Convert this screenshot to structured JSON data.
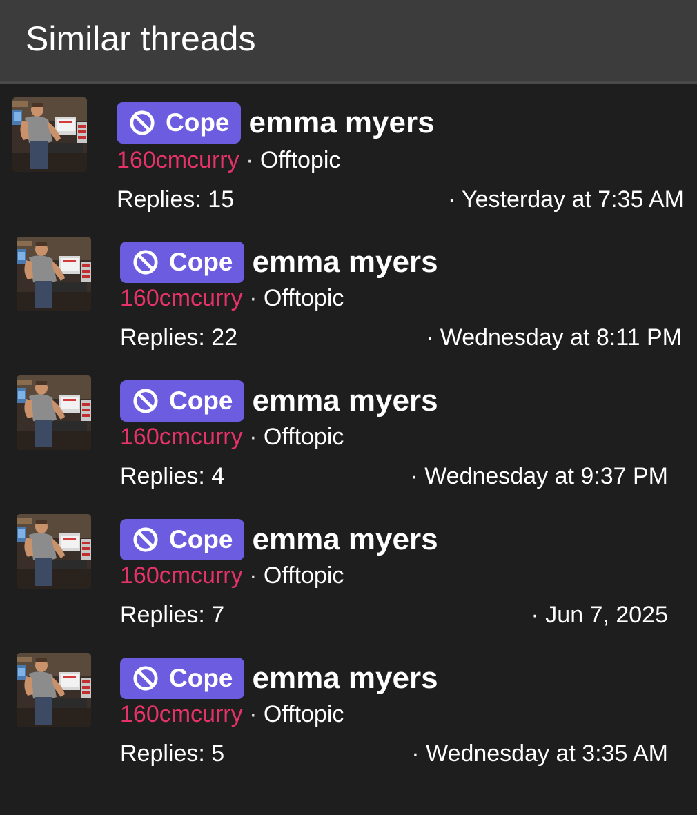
{
  "header": {
    "title": "Similar threads"
  },
  "threads": [
    {
      "prefix": "Cope",
      "title": "emma myers",
      "author": "160cmcurry",
      "separator": "·",
      "forum": "Offtopic",
      "replies": "Replies: 15",
      "date": "· Yesterday at 7:35 AM"
    },
    {
      "prefix": "Cope",
      "title": "emma myers",
      "author": "160cmcurry",
      "separator": "·",
      "forum": "Offtopic",
      "replies": "Replies: 22",
      "date": "· Wednesday at 8:11 PM"
    },
    {
      "prefix": "Cope",
      "title": "emma myers",
      "author": "160cmcurry",
      "separator": "·",
      "forum": "Offtopic",
      "replies": "Replies: 4",
      "date": "· Wednesday at 9:37 PM"
    },
    {
      "prefix": "Cope",
      "title": "emma myers",
      "author": "160cmcurry",
      "separator": "·",
      "forum": "Offtopic",
      "replies": "Replies: 7",
      "date": "· Jun 7, 2025"
    },
    {
      "prefix": "Cope",
      "title": "emma myers",
      "author": "160cmcurry",
      "separator": "·",
      "forum": "Offtopic",
      "replies": "Replies: 5",
      "date": "· Wednesday at 3:35 AM"
    }
  ],
  "icons": {
    "prefix_icon": "ban-icon",
    "avatar": "user-avatar"
  },
  "colors": {
    "prefix_bg": "#6b5ce0",
    "author": "#e5336a",
    "header_bg": "#3c3c3c",
    "panel_bg": "#1e1e1e"
  }
}
